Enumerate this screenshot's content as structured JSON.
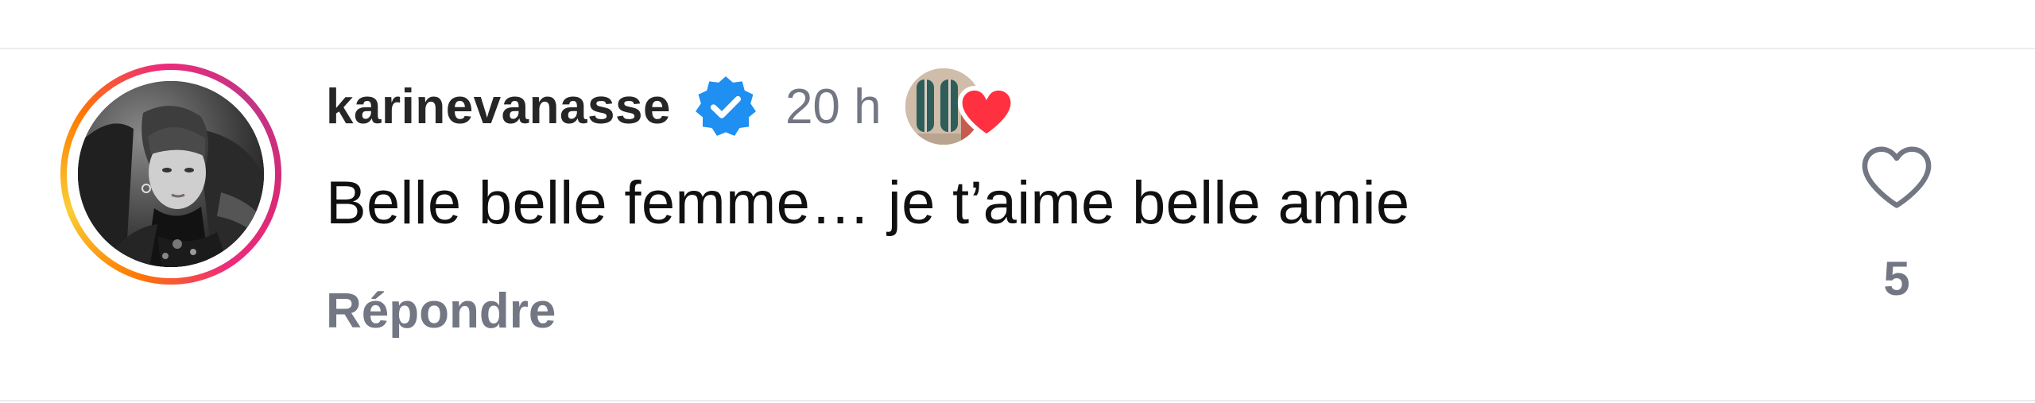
{
  "comment": {
    "username": "karinevanasse",
    "verified": true,
    "verified_icon": "verified-badge-icon",
    "time": "20 h",
    "text": "Belle belle femme… je t’aime belle amie",
    "reply_label": "Répondre",
    "like_count": "5",
    "like_icon": "heart-outline-icon",
    "author_liked_icon": "red-heart-icon"
  },
  "colors": {
    "verified": "#1f8ff2",
    "heart_red": "#ff3040",
    "muted_text": "#737784",
    "username": "#262626"
  }
}
